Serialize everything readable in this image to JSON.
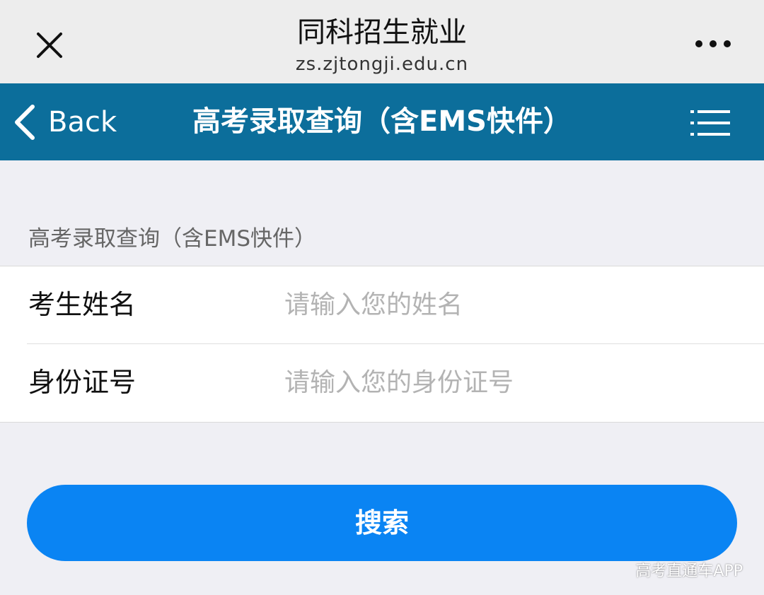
{
  "window": {
    "title": "同科招生就业",
    "url": "zs.zjtongji.edu.cn",
    "close_icon": "close-icon",
    "more_icon": "more-horizontal-icon"
  },
  "navbar": {
    "back_label": "Back",
    "back_icon": "chevron-left-icon",
    "title": "高考录取查询（含EMS快件）",
    "menu_icon": "list-menu-icon",
    "background_color": "#0c6e9b"
  },
  "section": {
    "title": "高考录取查询（含EMS快件）"
  },
  "form": {
    "name": {
      "label": "考生姓名",
      "value": "",
      "placeholder": "请输入您的姓名"
    },
    "id_number": {
      "label": "身份证号",
      "value": "",
      "placeholder": "请输入您的身份证号"
    }
  },
  "search_button": {
    "label": "搜索",
    "color": "#0a84f3"
  },
  "watermark": {
    "text": "高考直通车APP"
  }
}
